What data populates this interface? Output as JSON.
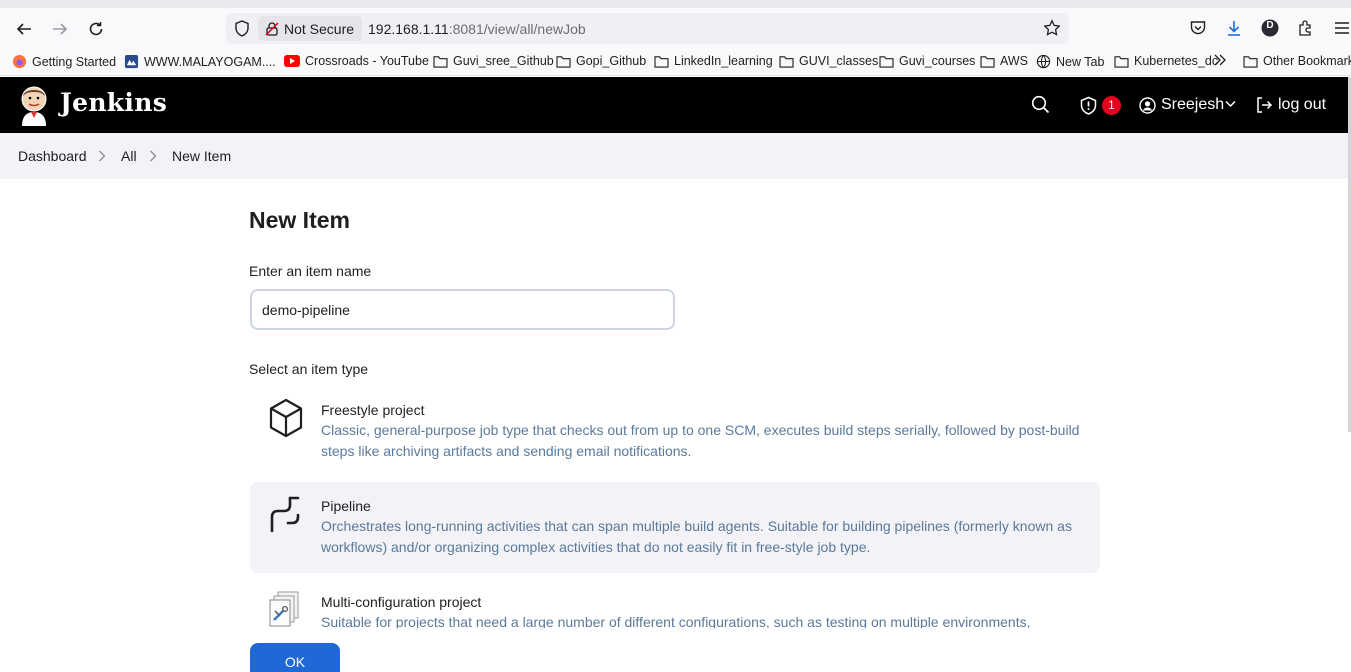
{
  "browser": {
    "security_label": "Not Secure",
    "url_host": "192.168.1.11",
    "url_path": ":8081/view/all/newJob",
    "profile_initial": "D",
    "bookmarks": [
      "Getting Started",
      "WWW.MALAYOGAM....",
      "Crossroads - YouTube",
      "Guvi_sree_Github",
      "Gopi_Github",
      "LinkedIn_learning",
      "GUVI_classes",
      "Guvi_courses",
      "AWS",
      "New Tab",
      "Kubernetes_dc",
      "Other Bookmarks"
    ]
  },
  "header": {
    "app_title": "Jenkins",
    "alert_count": "1",
    "user_name": "Sreejesh",
    "logout_label": "log out"
  },
  "breadcrumb": [
    "Dashboard",
    "All",
    "New Item"
  ],
  "main": {
    "title": "New Item",
    "name_label": "Enter an item name",
    "name_value": "demo-pipeline",
    "type_label": "Select an item type",
    "item_types": [
      {
        "name": "Freestyle project",
        "description": "Classic, general-purpose job type that checks out from up to one SCM, executes build steps serially, followed by post-build steps like archiving artifacts and sending email notifications.",
        "icon": "box-icon",
        "selected": false
      },
      {
        "name": "Pipeline",
        "description": "Orchestrates long-running activities that can span multiple build agents. Suitable for building pipelines (formerly known as workflows) and/or organizing complex activities that do not easily fit in free-style job type.",
        "icon": "pipeline-icon",
        "selected": true
      },
      {
        "name": "Multi-configuration project",
        "description": "Suitable for projects that need a large number of different configurations, such as testing on multiple environments,",
        "icon": "multi-config-icon",
        "selected": false
      }
    ],
    "ok_label": "OK"
  },
  "colors": {
    "header_bg": "#000000",
    "accent": "#1f68d6",
    "badge": "#e6001f",
    "selected_bg": "#f2f2f7",
    "description_text": "#5a7a9a"
  }
}
